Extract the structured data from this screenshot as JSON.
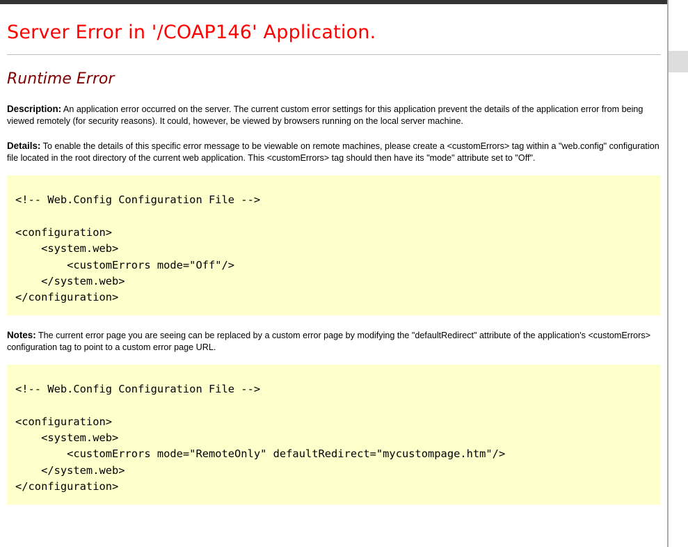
{
  "page": {
    "title": "Server Error in '/COAP146' Application.",
    "subtitle": "Runtime Error"
  },
  "description": {
    "label": "Description:",
    "text": " An application error occurred on the server. The current custom error settings for this application prevent the details of the application error from being viewed remotely (for security reasons). It could, however, be viewed by browsers running on the local server machine."
  },
  "details": {
    "label": "Details:",
    "text": " To enable the details of this specific error message to be viewable on remote machines, please create a <customErrors> tag within a \"web.config\" configuration file located in the root directory of the current web application. This <customErrors> tag should then have its \"mode\" attribute set to \"Off\"."
  },
  "code_block_1": {
    "lines": [
      "<!-- Web.Config Configuration File -->",
      "",
      "<configuration>",
      "    <system.web>",
      "        <customErrors mode=\"Off\"/>",
      "    </system.web>",
      "</configuration>"
    ]
  },
  "notes": {
    "label": "Notes:",
    "text": " The current error page you are seeing can be replaced by a custom error page by modifying the \"defaultRedirect\" attribute of the application's <customErrors> configuration tag to point to a custom error page URL."
  },
  "code_block_2": {
    "lines": [
      "<!-- Web.Config Configuration File -->",
      "",
      "<configuration>",
      "    <system.web>",
      "        <customErrors mode=\"RemoteOnly\" defaultRedirect=\"mycustompage.htm\"/>",
      "    </system.web>",
      "</configuration>"
    ]
  },
  "colors": {
    "title": "#ff0000",
    "subtitle": "#800000",
    "code_background": "#ffffcc",
    "divider": "#c0c0c0"
  }
}
